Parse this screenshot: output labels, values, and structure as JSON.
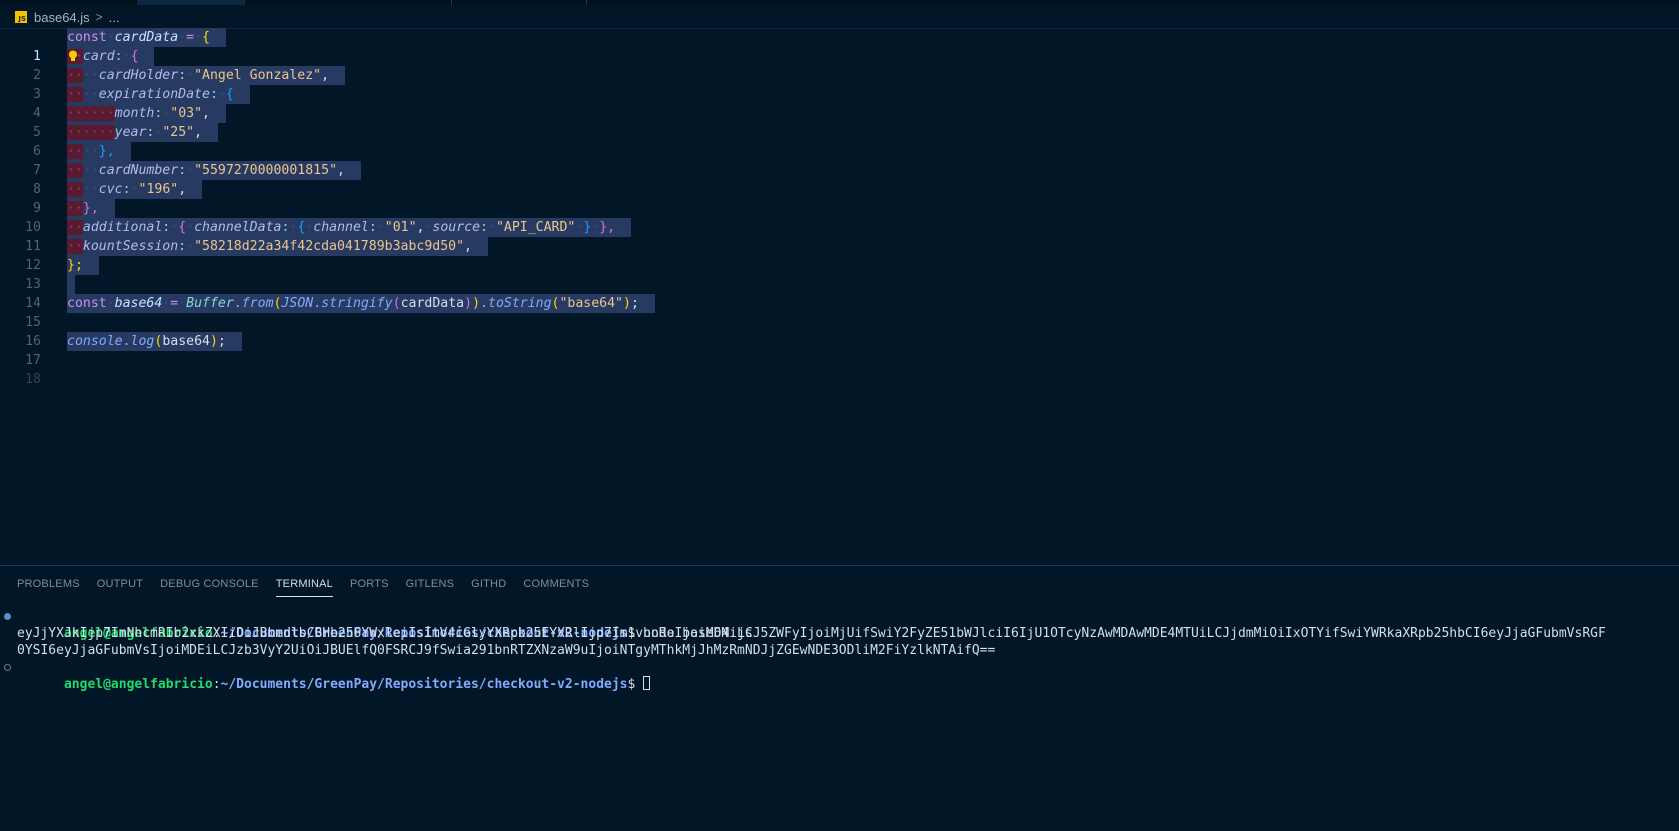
{
  "breadcrumb": {
    "file_icon": "javascript-file-icon",
    "file_name": "base64.js",
    "separator": ">",
    "more": "..."
  },
  "editor": {
    "line_numbers": [
      "1",
      "2",
      "3",
      "4",
      "5",
      "6",
      "7",
      "8",
      "9",
      "10",
      "11",
      "12",
      "13",
      "14",
      "15",
      "16",
      "17",
      "18"
    ],
    "active_line": "1",
    "code": {
      "l1": {
        "kw": "const",
        "var": "cardData",
        "eq": "=",
        "brace": "{"
      },
      "l2": {
        "prop": "card",
        "colon": ":",
        "brace": "{"
      },
      "l3": {
        "prop": "cardHolder",
        "colon": ":",
        "value": "\"Angel Gonzalez\"",
        "comma": ","
      },
      "l4": {
        "prop": "expirationDate",
        "colon": ":",
        "brace": "{"
      },
      "l5": {
        "prop": "month",
        "colon": ":",
        "value": "\"03\"",
        "comma": ","
      },
      "l6": {
        "prop": "year",
        "colon": ":",
        "value": "\"25\"",
        "comma": ","
      },
      "l7": {
        "close": "},"
      },
      "l8": {
        "prop": "cardNumber",
        "colon": ":",
        "value": "\"5597270000001815\"",
        "comma": ","
      },
      "l9": {
        "prop": "cvc",
        "colon": ":",
        "value": "\"196\"",
        "comma": ","
      },
      "l10": {
        "close": "},"
      },
      "l11": {
        "prop": "additional",
        "colon": ":",
        "open1": "{",
        "prop2": "channelData",
        "colon2": ":",
        "open2": "{",
        "prop3": "channel",
        "colon3": ":",
        "value3": "\"01\"",
        "comma3": ",",
        "prop4": "source",
        "colon4": ":",
        "value4": "\"API_CARD\"",
        "close2": "}",
        "close1": "},"
      },
      "l12": {
        "prop": "kountSession",
        "colon": ":",
        "value": "\"58218d22a34f42cda041789b3abc9d50\"",
        "comma": ","
      },
      "l13": {
        "close": "};"
      },
      "l15": {
        "kw": "const",
        "var": "base64",
        "eq": "=",
        "cls": "Buffer",
        "dot1": ".",
        "fn1": "from",
        "p1": "(",
        "cls2": "JSON",
        "dot2": ".",
        "fn2": "stringify",
        "p2": "(",
        "arg": "cardData",
        "p3": ")",
        "p4": ")",
        "dot3": ".",
        "fn3": "toString",
        "p5": "(",
        "str": "\"base64\"",
        "p6": ")",
        "semi": ";"
      },
      "l17": {
        "obj": "console",
        "dot": ".",
        "fn": "log",
        "p1": "(",
        "arg": "base64",
        "p2": ")",
        "semi": ";"
      }
    }
  },
  "panel": {
    "tabs": [
      {
        "label": "PROBLEMS"
      },
      {
        "label": "OUTPUT"
      },
      {
        "label": "DEBUG CONSOLE"
      },
      {
        "label": "TERMINAL"
      },
      {
        "label": "PORTS"
      },
      {
        "label": "GITLENS"
      },
      {
        "label": "GITHD"
      },
      {
        "label": "COMMENTS"
      }
    ],
    "active_tab": "TERMINAL",
    "terminal": {
      "user": "angel@angelfabricio",
      "colon": ":",
      "path": "~/Documents/GreenPay/Repositories/checkout-v2-nodejs",
      "prompt_symbol": "$",
      "command": " node base64.js",
      "output_line1": "eyJjYXJkIjp7ImNhcmRIb2xkZXIiOiJBbmdlbCBHb256YWxleiIsImV4cGlyYXRpb25EYXRlIjp7Im1vbnRoIjoiMDMiLCJ5ZWFyIjoiMjUifSwiY2FyZE51bWJlciI6IjU1OTcyNzAwMDAwMDE4MTUiLCJjdmMiOiIxOTYifSwiYWRkaXRpb25hbCI6eyJjaGFubmVsRGF",
      "output_line2": "0YSI6eyJjaGFubmVsIjoiMDEiLCJzb3VyY2UiOiJBUElfQ0FSRCJ9fSwia291bnRTZXNzaW9uIjoiNTgyMThkMjJhMzRmNDJjZGEwNDE3ODliM2FiYzlkNTAifQ=="
    }
  },
  "colors": {
    "background": "#011627",
    "selection": "#263a62",
    "keyword": "#c792ea",
    "string": "#ecc48d",
    "function": "#82aaff",
    "terminal_user": "#22da6e",
    "terminal_path": "#82aaff"
  }
}
